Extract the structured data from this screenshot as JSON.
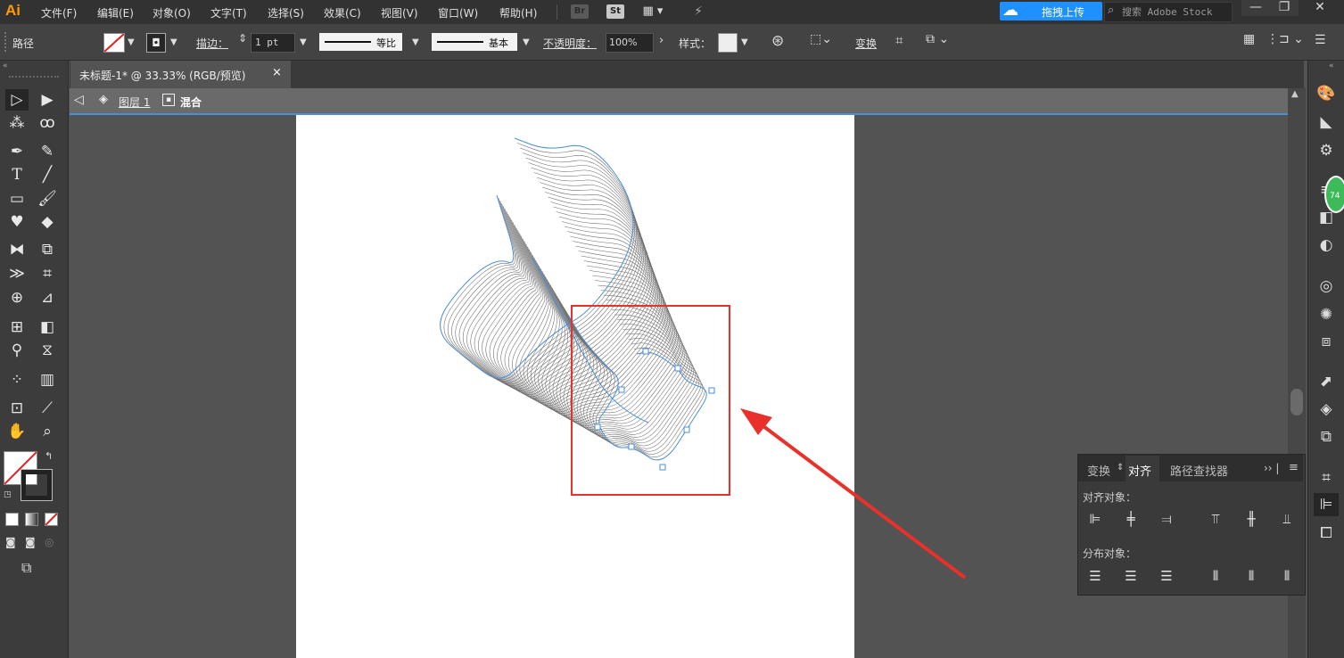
{
  "app": {
    "logo": "Ai",
    "menu": [
      "文件(F)",
      "编辑(E)",
      "对象(O)",
      "文字(T)",
      "选择(S)",
      "效果(C)",
      "视图(V)",
      "窗口(W)",
      "帮助(H)"
    ],
    "bridge_label": "Br",
    "stock_label": "St",
    "cloud_upload_label": "拖拽上传",
    "stock_search_placeholder": "搜索 Adobe Stock",
    "window_controls": [
      "—",
      "❐",
      "✕"
    ]
  },
  "control_bar": {
    "selection_type": "路径",
    "stroke_label": "描边：",
    "stroke_weight": "1 pt",
    "variable_width_label": "等比",
    "brush_label": "基本",
    "opacity_label": "不透明度：",
    "opacity_value": "100%",
    "style_label": "样式：",
    "transform_label": "变换"
  },
  "document": {
    "tab_title": "未标题-1* @ 33.33% (RGB/预览)",
    "tab_close": "×",
    "breadcrumb_layer": "图层 1",
    "breadcrumb_object": "混合"
  },
  "align_panel": {
    "tabs": [
      "变换",
      "对齐",
      "路径查找器"
    ],
    "active_tab": "对齐",
    "align_objects_label": "对齐对象：",
    "distribute_objects_label": "分布对象："
  },
  "badge_value": "74",
  "colors": {
    "accent_blue": "#4a90d9",
    "highlight_red": "#e8312a",
    "cloud_blue": "#1e90ff",
    "logo_orange": "#ff9a00"
  }
}
